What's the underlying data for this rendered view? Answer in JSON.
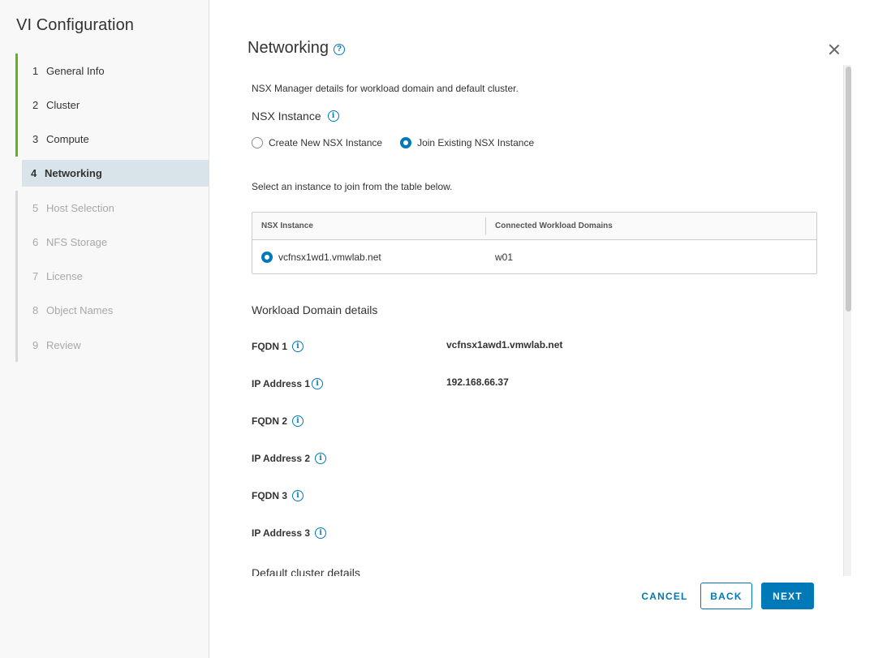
{
  "sidebar": {
    "title": "VI Configuration",
    "steps": [
      {
        "num": "1",
        "label": "General Info",
        "state": "done"
      },
      {
        "num": "2",
        "label": "Cluster",
        "state": "done"
      },
      {
        "num": "3",
        "label": "Compute",
        "state": "done"
      },
      {
        "num": "4",
        "label": "Networking",
        "state": "active"
      },
      {
        "num": "5",
        "label": "Host Selection",
        "state": "future"
      },
      {
        "num": "6",
        "label": "NFS Storage",
        "state": "future"
      },
      {
        "num": "7",
        "label": "License",
        "state": "future"
      },
      {
        "num": "8",
        "label": "Object Names",
        "state": "future"
      },
      {
        "num": "9",
        "label": "Review",
        "state": "future"
      }
    ]
  },
  "main": {
    "title": "Networking",
    "help_glyph": "?",
    "description": "NSX Manager details for workload domain and default cluster.",
    "nsx_section": {
      "heading": "NSX Instance",
      "info_glyph": "i",
      "options": [
        {
          "label": "Create New NSX Instance",
          "checked": false
        },
        {
          "label": "Join Existing NSX Instance",
          "checked": true
        }
      ]
    },
    "select_prompt": "Select an instance to join from the table below.",
    "table": {
      "columns": [
        "NSX Instance",
        "Connected Workload Domains"
      ],
      "rows": [
        {
          "instance": "vcfnsx1wd1.vmwlab.net",
          "domains": "w01",
          "selected": true
        }
      ]
    },
    "workload_section": {
      "heading": "Workload Domain details",
      "fields": [
        {
          "label": "FQDN 1",
          "value": "vcfnsx1awd1.vmwlab.net"
        },
        {
          "label": "IP Address 1",
          "value": "192.168.66.37"
        },
        {
          "label": "FQDN 2",
          "value": ""
        },
        {
          "label": "IP Address 2",
          "value": ""
        },
        {
          "label": "FQDN 3",
          "value": ""
        },
        {
          "label": "IP Address 3",
          "value": ""
        }
      ]
    },
    "default_cluster_heading": "Default cluster details"
  },
  "footer": {
    "cancel": "CANCEL",
    "back": "BACK",
    "next": "NEXT"
  },
  "colors": {
    "accent": "#0079b8",
    "done_step": "#5eb715",
    "active_step_bg": "#d9e4ea"
  }
}
